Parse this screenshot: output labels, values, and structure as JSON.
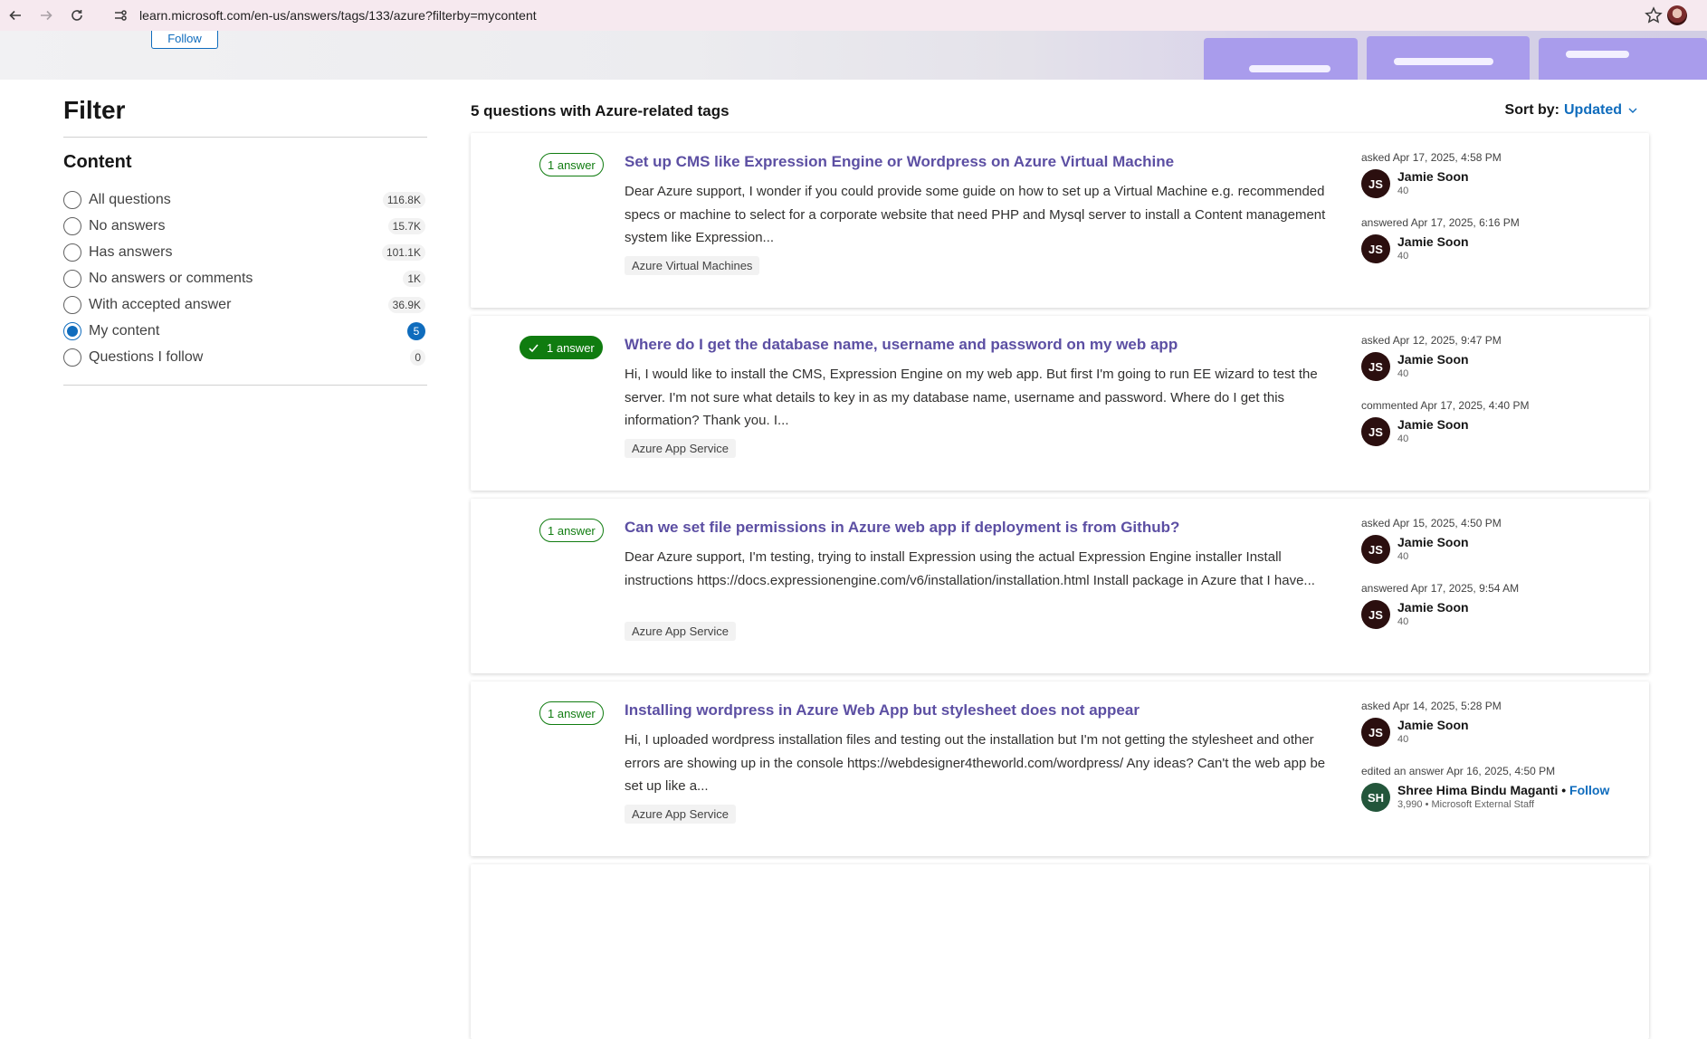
{
  "browser": {
    "url": "learn.microsoft.com/en-us/answers/tags/133/azure?filterby=mycontent"
  },
  "hero": {
    "follow_label": "Follow"
  },
  "sidebar": {
    "title": "Filter",
    "section_title": "Content",
    "items": [
      {
        "label": "All questions",
        "count": "116.8K",
        "checked": false
      },
      {
        "label": "No answers",
        "count": "15.7K",
        "checked": false
      },
      {
        "label": "Has answers",
        "count": "101.1K",
        "checked": false
      },
      {
        "label": "No answers or comments",
        "count": "1K",
        "checked": false
      },
      {
        "label": "With accepted answer",
        "count": "36.9K",
        "checked": false
      },
      {
        "label": "My content",
        "count": "5",
        "checked": true
      },
      {
        "label": "Questions I follow",
        "count": "0",
        "checked": false
      }
    ]
  },
  "results": {
    "title": "5 questions with Azure-related tags",
    "sort_label": "Sort by:",
    "sort_value": "Updated"
  },
  "questions": [
    {
      "answers": "1 answer",
      "accepted": false,
      "title": "Set up CMS like Expression Engine or Wordpress on Azure Virtual Machine",
      "body": "Dear Azure support, I wonder if you could provide some guide on how to set up a Virtual Machine e.g. recommended specs or machine to select for a corporate website that need PHP and Mysql server to install a Content management system like Expression...",
      "tag": "Azure Virtual Machines",
      "asked": "asked Apr 17, 2025, 4:58 PM",
      "asker": {
        "initials": "JS",
        "name": "Jamie Soon",
        "rep": "40"
      },
      "activity": "answered Apr 17, 2025, 6:16 PM",
      "actor": {
        "initials": "JS",
        "name": "Jamie Soon",
        "rep": "40"
      }
    },
    {
      "answers": "1 answer",
      "accepted": true,
      "title": "Where do I get the database name, username and password on my web app",
      "body": "Hi, I would like to install the CMS, Expression Engine on my web app. But first I'm going to run EE wizard to test the server. I'm not sure what details to key in as my database name, username and password. Where do I get this information? Thank you. I...",
      "tag": "Azure App Service",
      "asked": "asked Apr 12, 2025, 9:47 PM",
      "asker": {
        "initials": "JS",
        "name": "Jamie Soon",
        "rep": "40"
      },
      "activity": "commented Apr 17, 2025, 4:40 PM",
      "actor": {
        "initials": "JS",
        "name": "Jamie Soon",
        "rep": "40"
      }
    },
    {
      "answers": "1 answer",
      "accepted": false,
      "title": "Can we set file permissions in Azure web app if deployment is from Github?",
      "body": "Dear Azure support, I'm testing, trying to install Expression using the actual Expression Engine installer Install instructions https://docs.expressionengine.com/v6/installation/installation.html Install package in Azure that I have...",
      "tag": "Azure App Service",
      "asked": "asked Apr 15, 2025, 4:50 PM",
      "asker": {
        "initials": "JS",
        "name": "Jamie Soon",
        "rep": "40"
      },
      "activity": "answered Apr 17, 2025, 9:54 AM",
      "actor": {
        "initials": "JS",
        "name": "Jamie Soon",
        "rep": "40"
      }
    },
    {
      "answers": "1 answer",
      "accepted": false,
      "title": "Installing wordpress in Azure Web App but stylesheet does not appear",
      "body": "Hi, I uploaded wordpress installation files and testing out the installation but I'm not getting the stylesheet and other errors are showing up in the console https://webdesigner4theworld.com/wordpress/ Any ideas? Can't the web app be set up like a...",
      "tag": "Azure App Service",
      "asked": "asked Apr 14, 2025, 5:28 PM",
      "asker": {
        "initials": "JS",
        "name": "Jamie Soon",
        "rep": "40"
      },
      "activity": "edited an answer Apr 16, 2025, 4:50 PM",
      "actor": {
        "initials": "SH",
        "name": "Shree Hima Bindu Maganti",
        "rep": "3,990 • Microsoft External Staff",
        "follow": "Follow"
      }
    }
  ]
}
